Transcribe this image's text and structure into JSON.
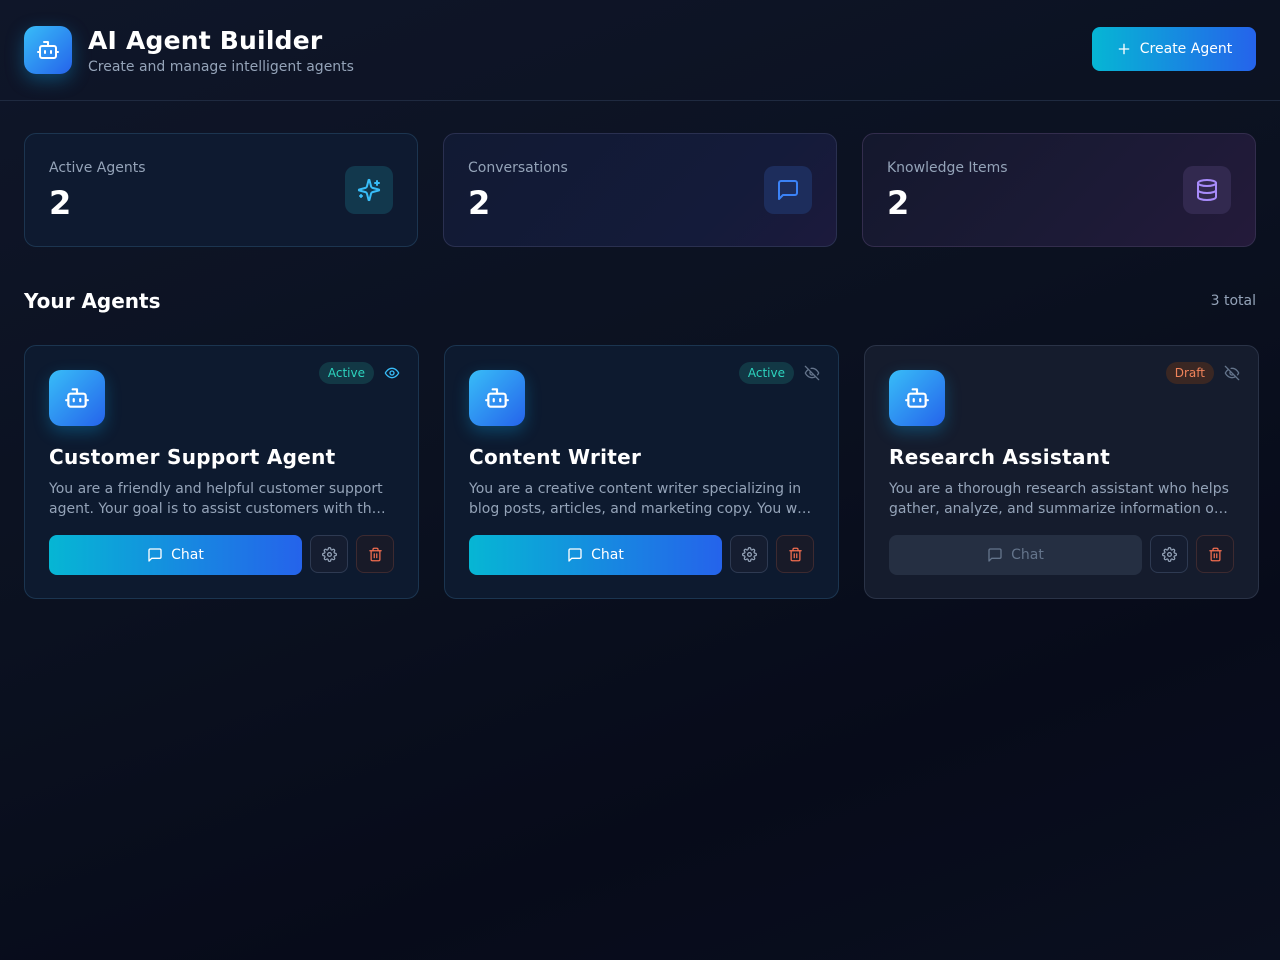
{
  "header": {
    "title": "AI Agent Builder",
    "subtitle": "Create and manage intelligent agents",
    "create_label": "Create Agent",
    "logo_icon": "robot-icon"
  },
  "stats": [
    {
      "label": "Active Agents",
      "value": "2",
      "icon": "sparkles-icon",
      "color": "#38bdf8"
    },
    {
      "label": "Conversations",
      "value": "2",
      "icon": "message-square-icon",
      "color": "#3b82f6"
    },
    {
      "label": "Knowledge Items",
      "value": "2",
      "icon": "database-icon",
      "color": "#a78bfa"
    }
  ],
  "agents_section": {
    "title": "Your Agents",
    "count": "3 total"
  },
  "agents": [
    {
      "name": "Customer Support Agent",
      "status": "Active",
      "visibility_icon": "eye-icon",
      "description_line1": "You are a friendly and helpful customer support",
      "description_line2": "agent. Your goal is to assist customers with their questions",
      "chat_label": "Chat"
    },
    {
      "name": "Content Writer",
      "status": "Active",
      "visibility_icon": "eye-off-icon",
      "description_line1": "You are a creative content writer specializing in",
      "description_line2": "blog posts, articles, and marketing copy. You write engaging content",
      "chat_label": "Chat"
    },
    {
      "name": "Research Assistant",
      "status": "Draft",
      "visibility_icon": "eye-off-icon",
      "description_line1": "You are a thorough research assistant who helps",
      "description_line2": "gather, analyze, and summarize information on any topic",
      "chat_label": "Chat"
    }
  ],
  "colors": {
    "accent_start": "#06b6d4",
    "accent_end": "#2563eb",
    "active_badge": "#2dd4bf",
    "draft_badge": "#f0835a",
    "delete": "#f26d4f"
  }
}
